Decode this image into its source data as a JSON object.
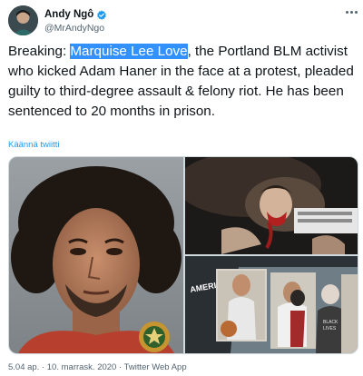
{
  "author": {
    "display_name": "Andy Ngô",
    "handle": "@MrAndyNgo",
    "verified_icon": "verified-badge-icon",
    "avatar_icon": "avatar"
  },
  "tweet": {
    "text_before": "Breaking: ",
    "highlighted": "Marquise Lee Love",
    "text_after": ", the Portland BLM activist who kicked Adam Haner in the face at a protest, pleaded guilty to third-degree assault & felony riot. He has been sentenced to 20 months in prison.",
    "translate_label": "Käännä twiitti",
    "timestamp": "5.04 ap. · 10. marrask. 2020 · Twitter Web App"
  },
  "media": {
    "images": [
      "mugshot-image",
      "injured-man-image",
      "protest-scene-image"
    ]
  },
  "colors": {
    "accent": "#1d9bf0",
    "selection": "#3390ff",
    "text": "#0f1419",
    "secondary": "#536471"
  }
}
